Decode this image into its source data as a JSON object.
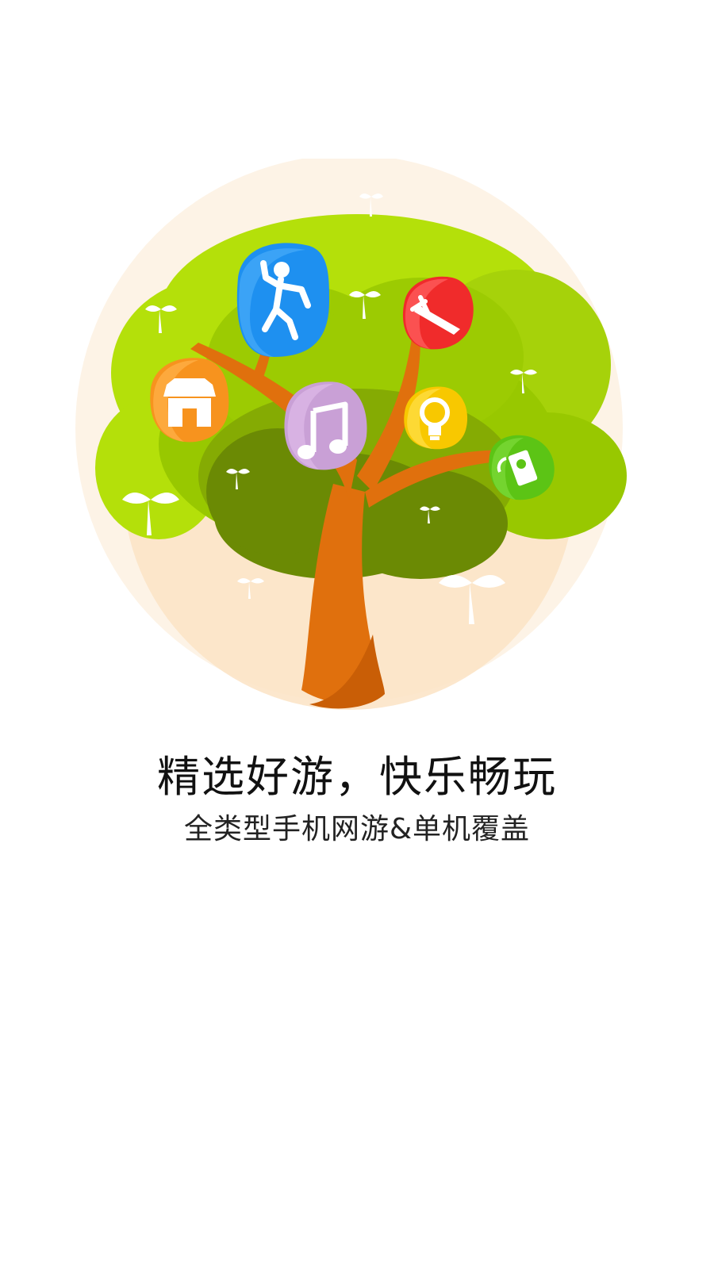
{
  "splash": {
    "title": "精选好游，快乐畅玩",
    "subtitle": "全类型手机网游&单机覆盖"
  },
  "illustration": {
    "description_icons": [
      "person-dancing-icon",
      "sword-icon",
      "store-icon",
      "music-note-icon",
      "lightbulb-icon",
      "camera-icon"
    ],
    "colors": {
      "halo": "#fdf1e2",
      "halo_inner": "#fbdcb4",
      "leaf_light": "#b4e00a",
      "leaf_mid": "#98c800",
      "leaf_dark": "#6b8a04",
      "trunk": "#e0700d",
      "blue_badge": "#1e90f0",
      "red_badge": "#f02b2b",
      "orange_badge": "#f7931e",
      "purple_badge": "#c9a0d6",
      "yellow_badge": "#f8c800",
      "green_badge": "#5cc415"
    }
  }
}
